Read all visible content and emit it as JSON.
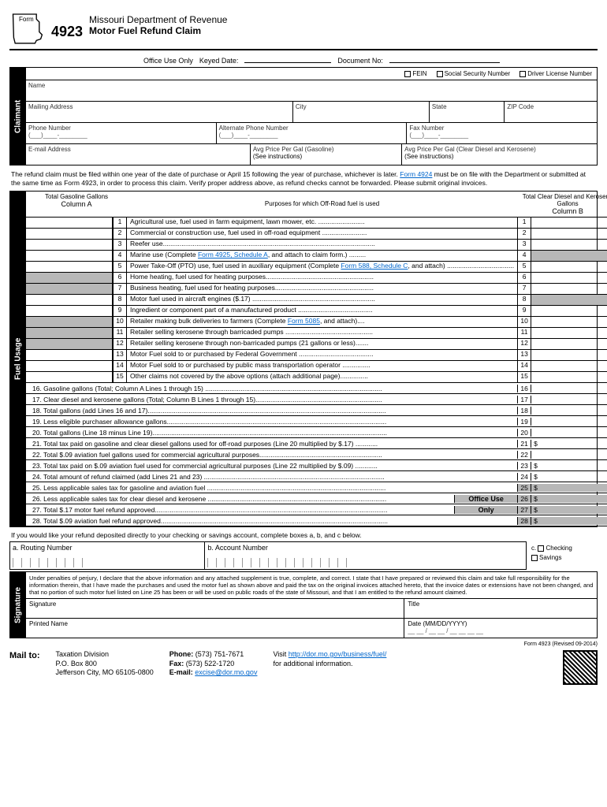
{
  "header": {
    "form_word": "Form",
    "form_num": "4923",
    "dept": "Missouri Department of Revenue",
    "title": "Motor Fuel Refund Claim"
  },
  "office": {
    "label": "Office Use Only",
    "keyed": "Keyed Date:",
    "doc": "Document No:"
  },
  "ids": {
    "fein": "FEIN",
    "ssn": "Social Security Number",
    "dln": "Driver License Number"
  },
  "claimant": {
    "tab": "Claimant",
    "name": "Name",
    "mail": "Mailing Address",
    "city": "City",
    "state": "State",
    "zip": "ZIP Code",
    "phone": "Phone Number",
    "alt": "Alternate Phone Number",
    "fax": "Fax Number",
    "email": "E-mail Address",
    "avg_gas": "Avg Price Per Gal (Gasoline)",
    "see": "(See instructions)",
    "avg_diesel": "Avg Price Per Gal (Clear Diesel and Kerosene)",
    "phone_fmt": "(___)____-________"
  },
  "instr": {
    "p1": "The refund claim must be filed within one year of the date of purchase or April 15 following the year of purchase, whichever is later. ",
    "link1": "Form 4924",
    "p2": " must be on file with the Department or submitted at the same time as Form 4923, in order to process this claim. Verify proper address above, as refund checks cannot be forwarded.  Please submit original invoices."
  },
  "fuel": {
    "tab": "Fuel Usage",
    "colA_head": "Total Gasoline Gallons",
    "colA": "Column A",
    "mid_head": "Purposes for which Off-Road fuel is used",
    "colB_head": "Total Clear Diesel and Kerosene Gallons",
    "colB": "Column B",
    "rows": [
      {
        "n": "1",
        "t": "Agricultural use, fuel used in farm equipment, lawn mower, etc. .........................",
        "sA": false,
        "sB": false
      },
      {
        "n": "2",
        "t": "Commercial or construction use, fuel used in off-road equipment ........................",
        "sA": false,
        "sB": false
      },
      {
        "n": "3",
        "t": "Reefer use..................................................................................................................",
        "sA": false,
        "sB": false
      },
      {
        "n": "4",
        "t": "Marine use (Complete Form 4925, Schedule A, and attach to claim form.) .........",
        "sA": false,
        "sB": true,
        "link": "Form 4925, Schedule A"
      },
      {
        "n": "5",
        "t": "Power Take-Off (PTO) use, fuel used in auxiliary equipment (Complete Form 588, Schedule C, and attach) ....................................",
        "sA": false,
        "sB": false,
        "link": "Form 588, Schedule C"
      },
      {
        "n": "6",
        "t": "Home heating, fuel used for heating purposes..........................................................",
        "sA": true,
        "sB": false
      },
      {
        "n": "7",
        "t": "Business heating, fuel used for heating purposes.....................................................",
        "sA": true,
        "sB": false
      },
      {
        "n": "8",
        "t": "Motor fuel used in aircraft engines ($.17) ..................................................................",
        "sA": false,
        "sB": true
      },
      {
        "n": "9",
        "t": "Ingredient or component part of a manufactured product ........................................",
        "sA": false,
        "sB": false
      },
      {
        "n": "10",
        "t": "Retailer making bulk deliveries to farmers (Complete Form 5085, and attach)....",
        "sA": true,
        "sB": false,
        "link": "Form 5085"
      },
      {
        "n": "11",
        "t": "Retailer selling kerosene through barricaded pumps ...............................................",
        "sA": true,
        "sB": false
      },
      {
        "n": "12",
        "t": "Retailer selling kerosene through non-barricaded pumps (21 gallons or less).......",
        "sA": true,
        "sB": false
      },
      {
        "n": "13",
        "t": "Motor Fuel sold to or purchased by Federal Government ........................................",
        "sA": false,
        "sB": false
      },
      {
        "n": "14",
        "t": "Motor Fuel sold to or purchased by public mass transportation operator ...............",
        "sA": false,
        "sB": false
      },
      {
        "n": "15",
        "t": "Other claims not covered by the above options (attach additional page)...............",
        "sA": false,
        "sB": false
      }
    ],
    "sums": [
      {
        "n": "16",
        "t": "16.   Gasoline gallons (Total; Column A Lines 1 through 15) ...............................................................................................",
        "d": false
      },
      {
        "n": "17",
        "t": "17.   Clear diesel and kerosene gallons (Total; Column B Lines 1 through 15)....................................................................",
        "d": false
      },
      {
        "n": "18",
        "t": "18.   Total gallons (add Lines 16 and 17)................................................................................................................................",
        "d": false
      },
      {
        "n": "19",
        "t": "19.   Less eligible purchaser allowance gallons......................................................................................................................",
        "d": false
      },
      {
        "n": "20",
        "t": "20.   Total gallons (Line 18 minus Line 19)..............................................................................................................................",
        "d": false
      },
      {
        "n": "21",
        "t": "21.   Total tax paid on gasoline and clear diesel gallons used for off-road purposes (Line 20 multiplied by $.17) ............",
        "d": true
      },
      {
        "n": "22",
        "t": "22.   Total $.09 aviation fuel gallons used for commercial agricultural purposes..................................................................",
        "d": false
      },
      {
        "n": "23",
        "t": "23.   Total tax paid on $.09 aviation fuel used for commercial agricultural purposes (Line 22 multiplied by $.09) ............",
        "d": true
      },
      {
        "n": "24",
        "t": "24.   Total amount of refund claimed (add Lines 21 and 23) .................................................................................................",
        "d": true
      },
      {
        "n": "25",
        "t": "25.   Less applicable sales tax for gasoline and aviation fuel ................................................................................................",
        "d": true,
        "ou": true
      },
      {
        "n": "26",
        "t": "26.   Less applicable sales tax for clear diesel and kerosene ................................................................................................",
        "d": true,
        "ou": true
      },
      {
        "n": "27",
        "t": "27.   Total $.17 motor fuel refund approved.............................................................................................................................",
        "d": true,
        "ou": true
      },
      {
        "n": "28",
        "t": "28.   Total $.09 aviation fuel refund approved..........................................................................................................................",
        "d": true,
        "ou": true
      }
    ],
    "office_only": "Office Use Only"
  },
  "deposit": {
    "intro": "If you would like your refund deposited directly to your checking or savings account, complete boxes a, b, and c below.",
    "a": "a. Routing Number",
    "b": "b. Account Number",
    "c": "c.",
    "chk": "Checking",
    "sav": "Savings"
  },
  "sig": {
    "tab": "Signature",
    "decl": "Under penalties of perjury, I declare that the above information and any attached supplement is true, complete, and correct. I state that I have prepared or reviewed this claim and take full responsibility for the information therein, that I have made the purchases and used the motor fuel as shown above and paid the tax on the original invoices attached hereto, that the invoice dates or extensions have not been changed, and that no portion of such motor fuel listed on Line 25 has been or will be used on public roads of the state of Missouri, and that I am entitled to the refund amount claimed.",
    "sig": "Signature",
    "title": "Title",
    "printed": "Printed Name",
    "date": "Date (MM/DD/YYYY)",
    "date_fmt": "__ __ / __ __ / __ __ __ __"
  },
  "footer": {
    "mail": "Mail to:",
    "addr1": "Taxation Division",
    "addr2": "P.O. Box 800",
    "addr3": "Jefferson City, MO 65105-0800",
    "phone_l": "Phone:",
    "phone": "(573) 751-7671",
    "fax_l": "Fax:",
    "fax": "(573) 522-1720",
    "email_l": "E-mail:",
    "email": "excise@dor.mo.gov",
    "visit": "Visit ",
    "url": "http://dor.mo.gov/business/fuel/",
    "add": "for additional information.",
    "rev": "Form 4923 (Revised 09-2014)"
  }
}
